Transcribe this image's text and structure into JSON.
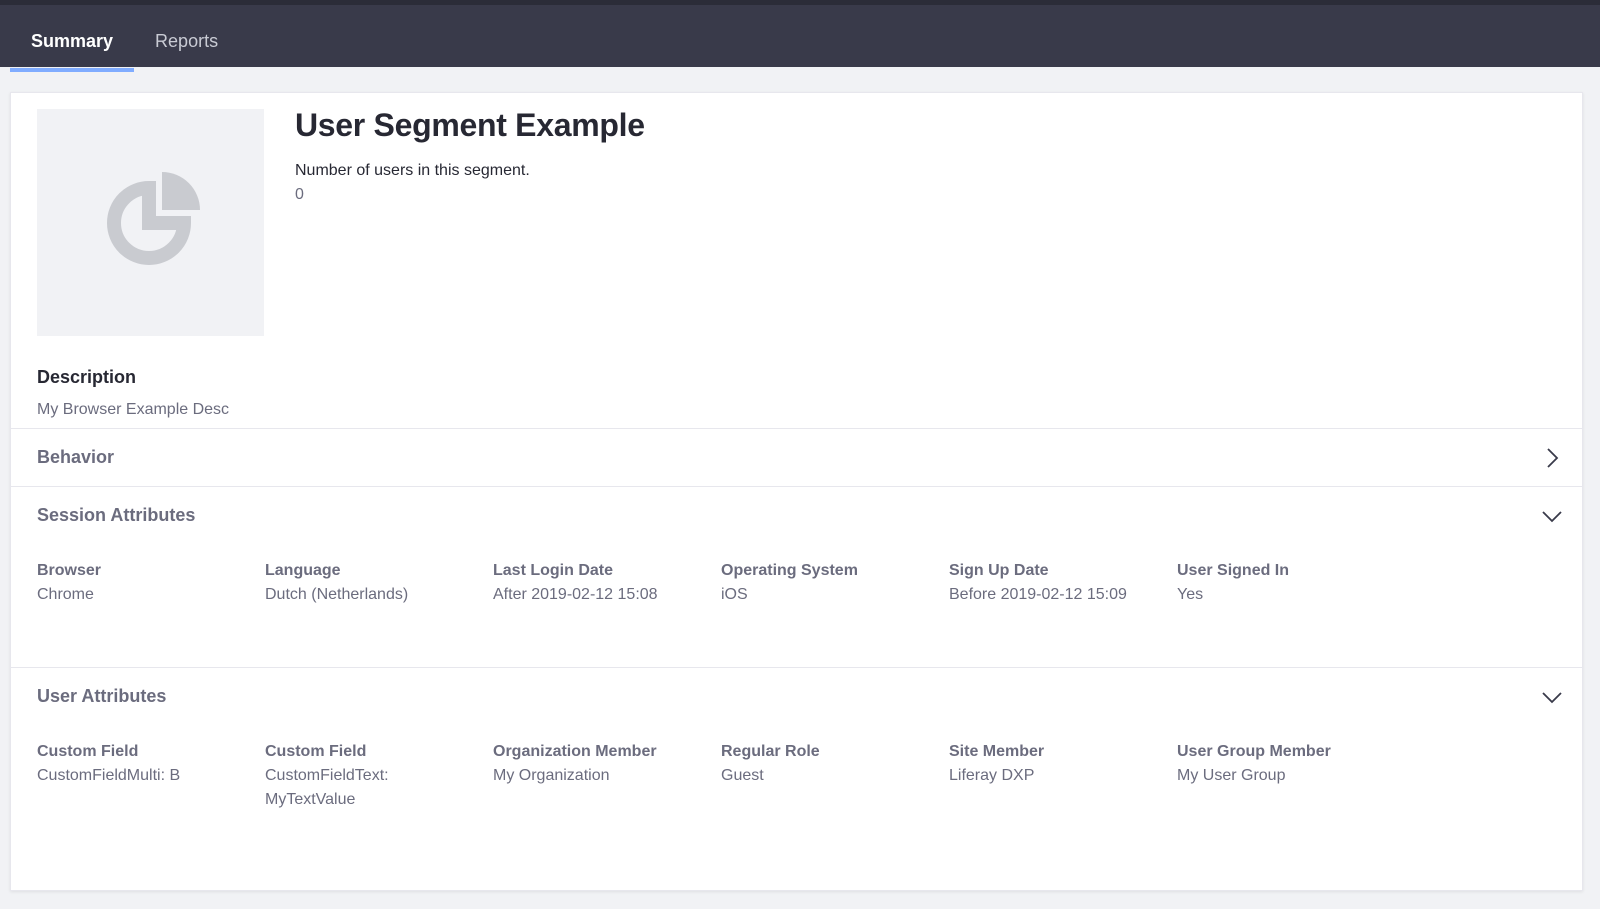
{
  "tabs": [
    {
      "label": "Summary",
      "active": true
    },
    {
      "label": "Reports",
      "active": false
    }
  ],
  "segment": {
    "title": "User Segment Example",
    "users_label": "Number of users in this segment.",
    "users_count": "0",
    "image_icon": "pie-chart-icon",
    "description_heading": "Description",
    "description_text": "My Browser Example Desc"
  },
  "panels": {
    "behavior": {
      "title": "Behavior",
      "expanded": false,
      "icon": "chevron-right-icon"
    },
    "session": {
      "title": "Session Attributes",
      "expanded": true,
      "icon": "chevron-down-icon",
      "attributes": [
        {
          "label": "Browser",
          "value": "Chrome"
        },
        {
          "label": "Language",
          "value": "Dutch (Netherlands)"
        },
        {
          "label": "Last Login Date",
          "value": "After 2019-02-12 15:08"
        },
        {
          "label": "Operating System",
          "value": "iOS"
        },
        {
          "label": "Sign Up Date",
          "value": "Before 2019-02-12 15:09"
        },
        {
          "label": "User Signed In",
          "value": "Yes"
        }
      ]
    },
    "user": {
      "title": "User Attributes",
      "expanded": true,
      "icon": "chevron-down-icon",
      "attributes": [
        {
          "label": "Custom Field",
          "value": "CustomFieldMulti: B"
        },
        {
          "label": "Custom Field",
          "value": "CustomFieldText: MyTextValue"
        },
        {
          "label": "Organization Member",
          "value": "My Organization"
        },
        {
          "label": "Regular Role",
          "value": "Guest"
        },
        {
          "label": "Site Member",
          "value": "Liferay DXP"
        },
        {
          "label": "User Group Member",
          "value": "My User Group"
        }
      ]
    }
  },
  "colors": {
    "topbar": "#393a4a",
    "active_tab_indicator": "#80acff",
    "page_background": "#f1f2f5",
    "muted_text": "#6b6c7e"
  }
}
